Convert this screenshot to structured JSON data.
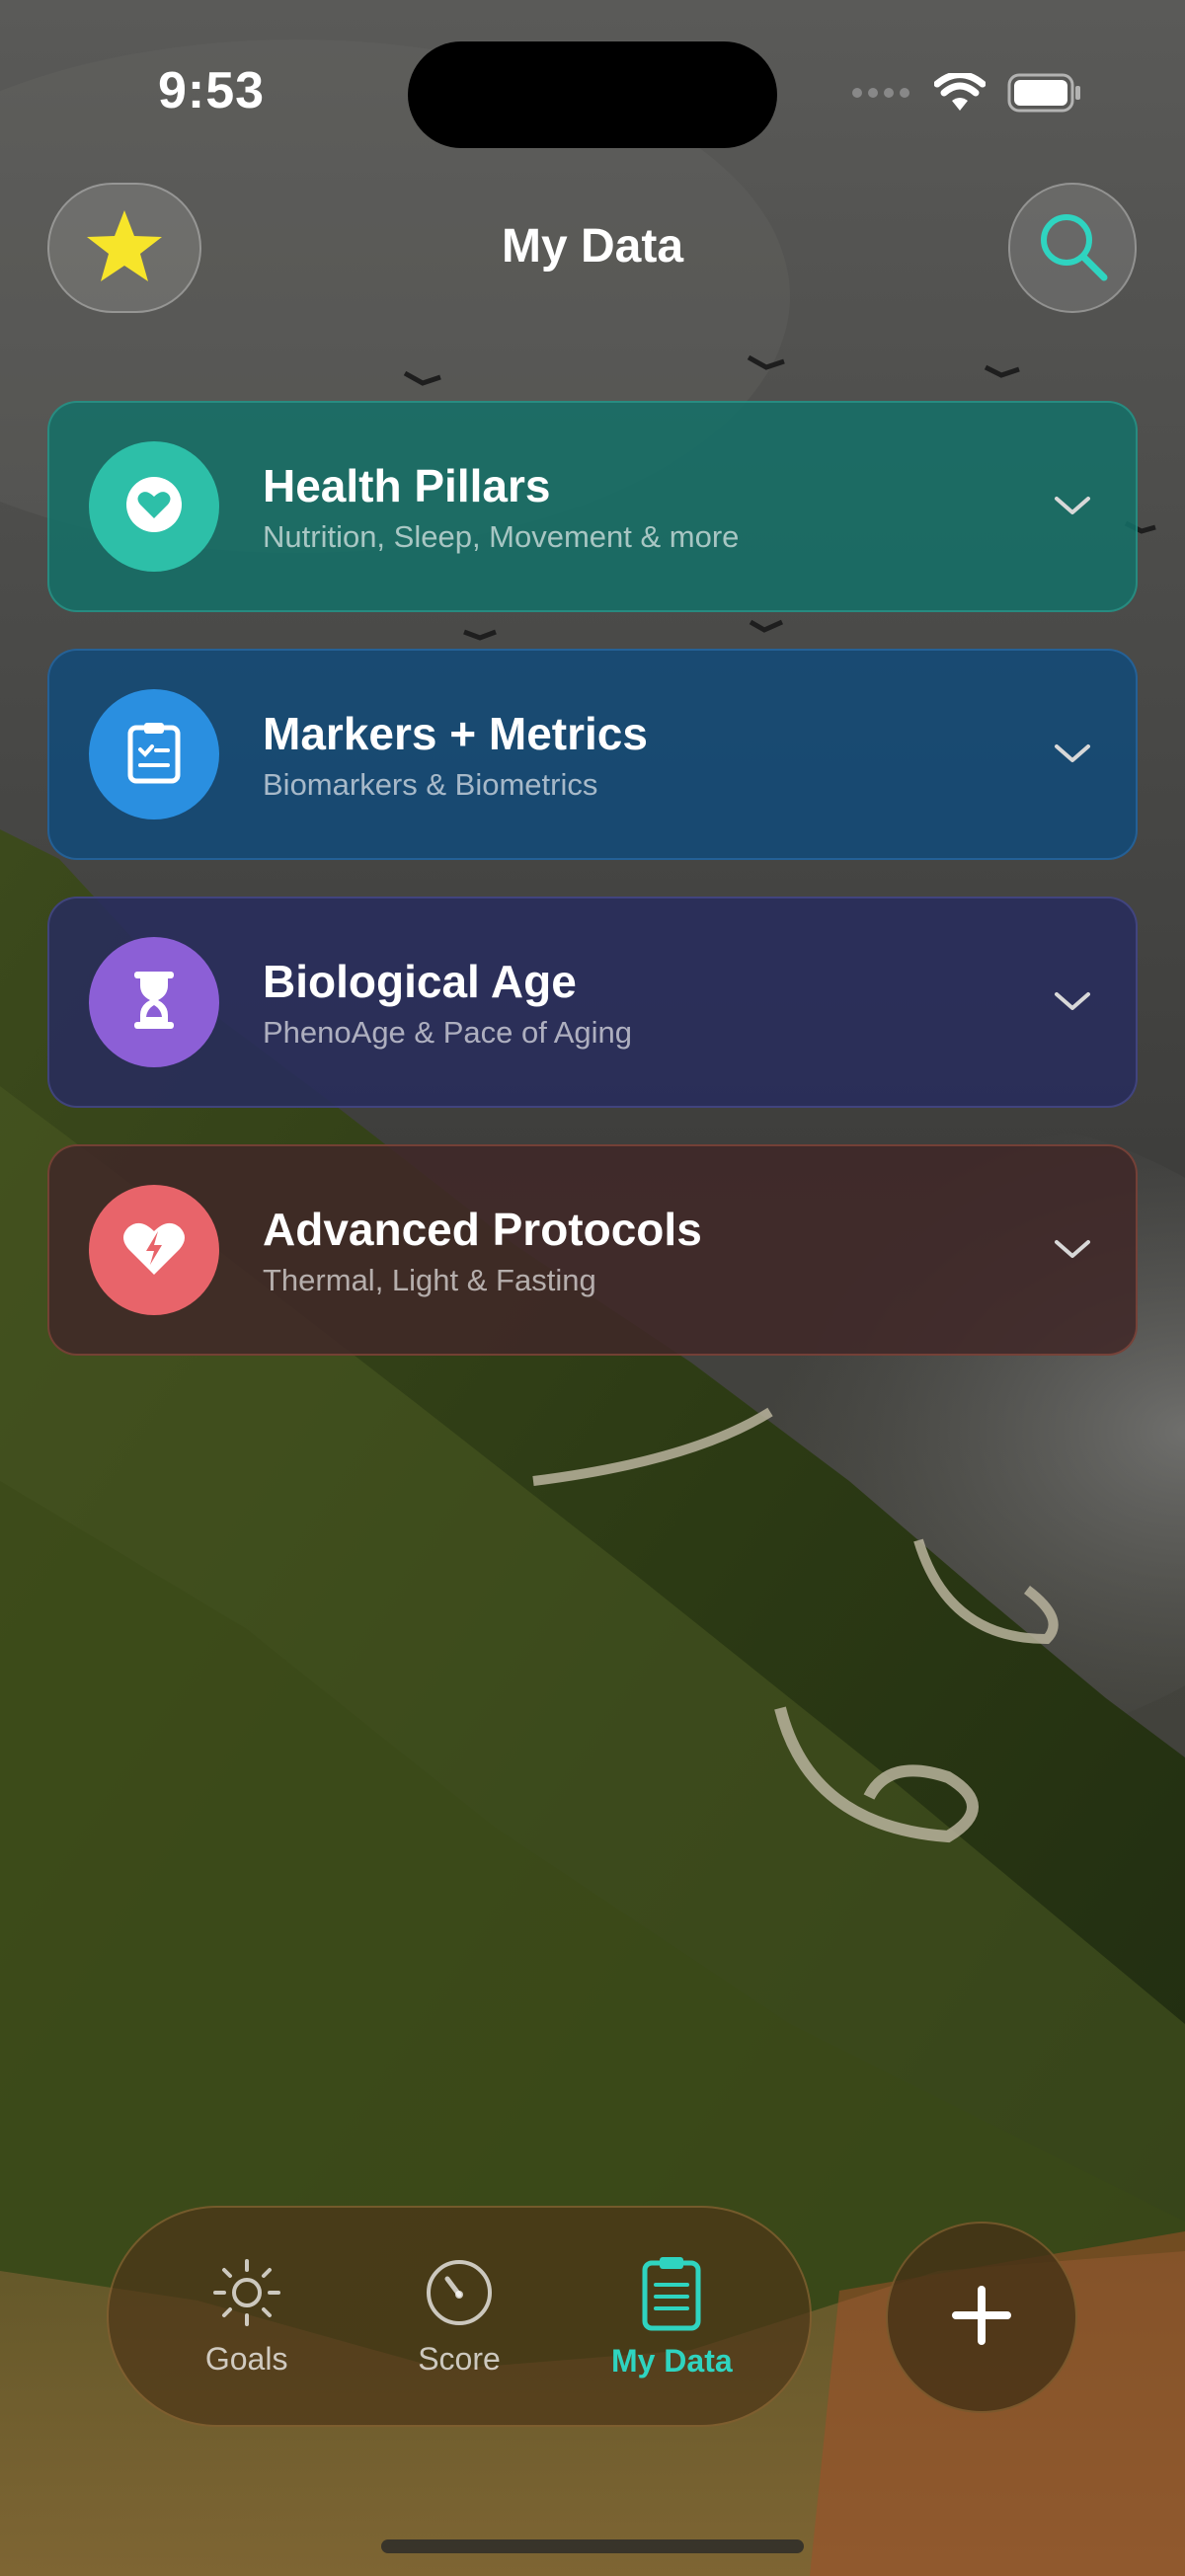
{
  "status_bar": {
    "time": "9:53"
  },
  "header": {
    "title": "My Data",
    "left_button_icon": "star-icon",
    "right_button_icon": "search-icon"
  },
  "cards": [
    {
      "title": "Health Pillars",
      "subtitle": "Nutrition, Sleep, Movement & more",
      "icon": "heart-icon",
      "accent": "#2dbfa8"
    },
    {
      "title": "Markers + Metrics",
      "subtitle": "Biomarkers & Biometrics",
      "icon": "clipboard-icon",
      "accent": "#2a8fe0"
    },
    {
      "title": "Biological Age",
      "subtitle": "PhenoAge & Pace of Aging",
      "icon": "hourglass-icon",
      "accent": "#8c5fd6"
    },
    {
      "title": "Advanced Protocols",
      "subtitle": "Thermal, Light & Fasting",
      "icon": "heart-bolt-icon",
      "accent": "#e8646a"
    }
  ],
  "tabbar": {
    "tabs": [
      {
        "label": "Goals",
        "icon": "sun-icon",
        "active": false
      },
      {
        "label": "Score",
        "icon": "gauge-icon",
        "active": false
      },
      {
        "label": "My Data",
        "icon": "clipboard-icon",
        "active": true
      }
    ],
    "active_color": "#2fd4c0",
    "add_button_icon": "plus-icon"
  }
}
